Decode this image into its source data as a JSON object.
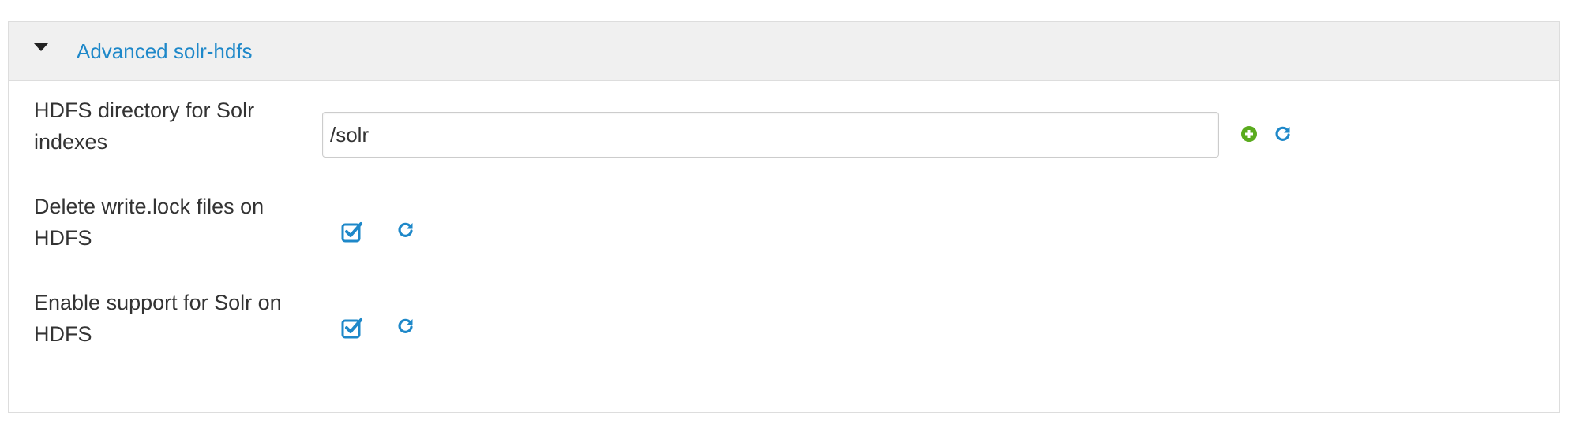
{
  "section": {
    "title": "Advanced solr-hdfs",
    "toggle_icon": "caret-down-icon"
  },
  "properties": [
    {
      "label": "HDFS directory for Solr indexes",
      "value": "/solr",
      "type": "text",
      "actions": [
        "plus-circle-icon",
        "refresh-icon"
      ]
    },
    {
      "label": "Delete write.lock files on HDFS",
      "checked": true,
      "type": "checkbox",
      "actions": [
        "refresh-icon"
      ]
    },
    {
      "label": "Enable support for Solr on HDFS",
      "checked": true,
      "type": "checkbox",
      "actions": [
        "refresh-icon"
      ]
    }
  ],
  "colors": {
    "accent": "#1e88c9",
    "add": "#5aab1e",
    "heading_bg": "#f0f0f0",
    "border": "#dddddd"
  }
}
